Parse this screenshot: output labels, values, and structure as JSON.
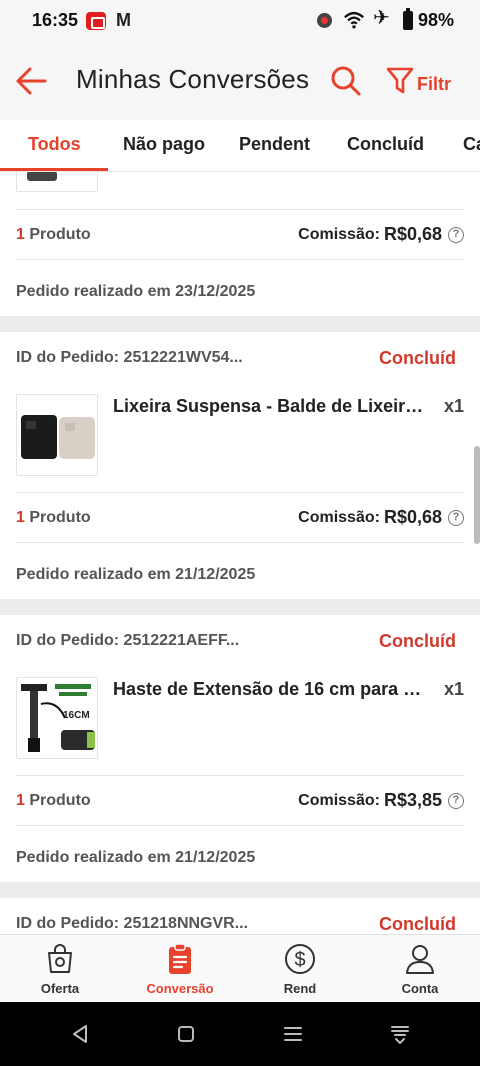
{
  "status_bar": {
    "time": "16:35",
    "mail_letter": "M",
    "battery": "98%"
  },
  "header": {
    "title": "Minhas Conversões",
    "filter_label": "Filtr"
  },
  "tabs": [
    {
      "label": "Todos",
      "active": true
    },
    {
      "label": "Não pago",
      "active": false
    },
    {
      "label": "Pendent",
      "active": false
    },
    {
      "label": "Concluíd",
      "active": false
    },
    {
      "label": "Ca",
      "active": false
    }
  ],
  "orders": [
    {
      "product_count_num": "1",
      "product_count_text": " Produto",
      "commission_label": "Comissão:",
      "commission_value": "R$0,68",
      "date": "Pedido realizado em 23/12/2025"
    },
    {
      "order_id": "ID do Pedido: 2512221WV54...",
      "status": "Concluíd",
      "product_name": "Lixeira Suspensa - Balde de Lixeiro ...",
      "qty": "x1",
      "product_count_num": "1",
      "product_count_text": " Produto",
      "commission_label": "Comissão:",
      "commission_value": "R$0,68",
      "date": "Pedido realizado em 21/12/2025"
    },
    {
      "order_id": "ID do Pedido: 2512221AEFF...",
      "status": "Concluíd",
      "product_name": "Haste de Extensão de 16 cm para M...",
      "qty": "x1",
      "thumb_text": "16CM",
      "product_count_num": "1",
      "product_count_text": " Produto",
      "commission_label": "Comissão:",
      "commission_value": "R$3,85",
      "date": "Pedido realizado em 21/12/2025"
    },
    {
      "order_id": "ID do Pedido: 251218NNGVR...",
      "status": "Concluíd"
    }
  ],
  "bottom_nav": [
    {
      "label": "Oferta",
      "icon": "shopping-bag-icon",
      "active": false
    },
    {
      "label": "Conversão",
      "icon": "clipboard-icon",
      "active": true
    },
    {
      "label": "Rend",
      "icon": "dollar-circle-icon",
      "active": false
    },
    {
      "label": "Conta",
      "icon": "user-icon",
      "active": false
    }
  ],
  "colors": {
    "accent": "#e8412c",
    "status": "#d0392b"
  }
}
